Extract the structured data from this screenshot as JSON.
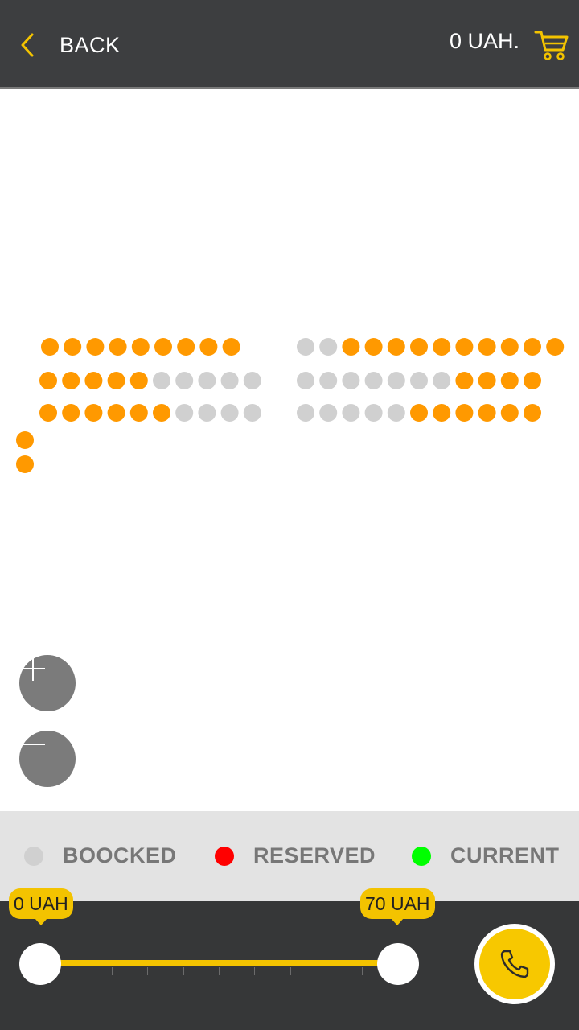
{
  "header": {
    "back_label": "BACK",
    "total_label": "0 UAH.",
    "back_icon": "chevron-left-icon",
    "cart_icon": "shopping-cart-icon"
  },
  "colors": {
    "accent": "#f3c300",
    "header_bg": "#3d3e40",
    "seat_available": "#ff9900",
    "seat_booked": "#d0d0d0",
    "seat_reserved": "#ff0000",
    "seat_current": "#00ff00"
  },
  "seat_map": {
    "rows": [
      {
        "left": "AAAAAAAAA",
        "right": "BBAAAAAAAAAA"
      },
      {
        "left": "AAAAABBBBB",
        "right": "BBBBBBBAAAA"
      },
      {
        "left": "AAAAAABBBB",
        "right": "BBBBBAAAAAA"
      }
    ],
    "extra_seats": [
      "A",
      "A"
    ]
  },
  "zoom": {
    "in_icon": "plus-icon",
    "out_icon": "minus-icon"
  },
  "legend": [
    {
      "label": "BOOCKED",
      "color": "#d0d0d0"
    },
    {
      "label": "RESERVED",
      "color": "#ff0000"
    },
    {
      "label": "CURRENT",
      "color": "#00ff00"
    }
  ],
  "price_filter": {
    "min_label": "0 UAH",
    "max_label": "70 UAH",
    "min_value": 0,
    "max_value": 70,
    "selected_min_fraction": 0,
    "selected_max_fraction": 1
  },
  "call_icon": "phone-icon"
}
